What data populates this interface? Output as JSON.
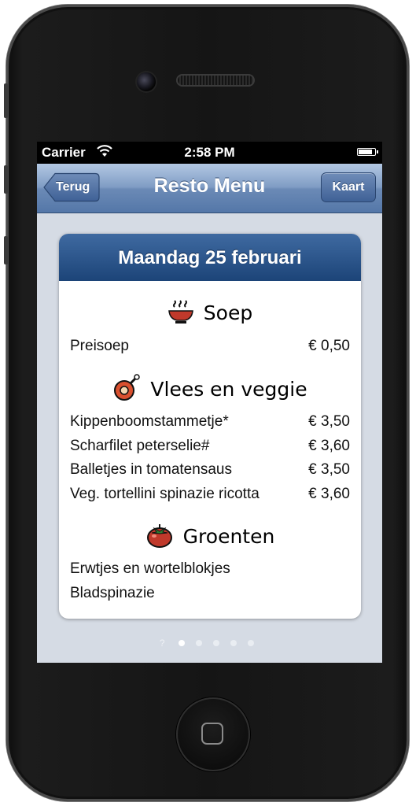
{
  "statusbar": {
    "carrier": "Carrier",
    "time": "2:58 PM",
    "battery_level": 0.9
  },
  "navbar": {
    "title": "Resto Menu",
    "back_label": "Terug",
    "right_label": "Kaart"
  },
  "card": {
    "date_title": "Maandag 25 februari",
    "sections": [
      {
        "title": "Soep",
        "icon": "soup-bowl-icon",
        "items": [
          {
            "name": "Preisoep",
            "price": "€ 0,50"
          }
        ]
      },
      {
        "title": "Vlees en veggie",
        "icon": "meat-icon",
        "items": [
          {
            "name": "Kippenboomstammetje*",
            "price": "€ 3,50"
          },
          {
            "name": "Scharfilet peterselie#",
            "price": "€ 3,60"
          },
          {
            "name": "Balletjes in tomatensaus",
            "price": "€ 3,50"
          },
          {
            "name": "Veg. tortellini spinazie ricotta",
            "price": "€ 3,60"
          }
        ]
      },
      {
        "title": "Groenten",
        "icon": "tomato-icon",
        "items": [
          {
            "name": "Erwtjes en wortelblokjes"
          },
          {
            "name": "Bladspinazie"
          }
        ]
      }
    ]
  },
  "pager": {
    "help_glyph": "?",
    "page_count": 5,
    "current_page": 1
  },
  "colors": {
    "nav_blue": "#5477a8",
    "card_header_blue": "#1c4478",
    "background": "#d5dbe4"
  }
}
